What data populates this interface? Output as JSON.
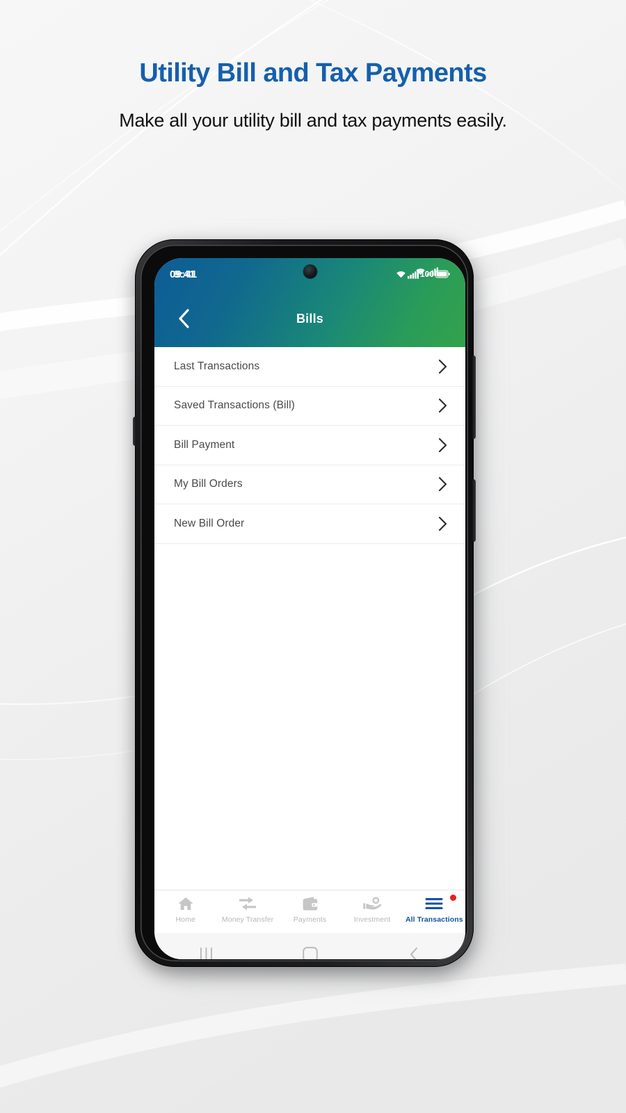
{
  "promo": {
    "title": "Utility Bill and Tax Payments",
    "subtitle": "Make all your utility bill and tax payments easily.",
    "title_color": "#1560ad",
    "subtitle_color": "#111111"
  },
  "phone": {
    "statusbar": {
      "time_primary": "09:41",
      "time_secondary": "9:41",
      "battery_text": "100",
      "icons": [
        "wifi-icon",
        "cellular-signal-icon",
        "wifi-icon",
        "battery-icon"
      ]
    },
    "header": {
      "title": "Bills",
      "back_icon": "chevron-left-icon",
      "gradient_from": "#0d5d96",
      "gradient_to": "#33a24c"
    },
    "menu_items": [
      {
        "label": "Last Transactions",
        "chevron": "chevron-right-icon"
      },
      {
        "label": "Saved Transactions (Bill)",
        "chevron": "chevron-right-icon"
      },
      {
        "label": "Bill Payment",
        "chevron": "chevron-right-icon"
      },
      {
        "label": "My Bill Orders",
        "chevron": "chevron-right-icon"
      },
      {
        "label": "New Bill Order",
        "chevron": "chevron-right-icon"
      }
    ],
    "tabbar": {
      "active_color": "#17529e",
      "inactive_color": "#b6b6b6",
      "badge_color": "#e8201f",
      "tabs": [
        {
          "label": "Home",
          "icon": "home-icon",
          "active": false,
          "badge": false
        },
        {
          "label": "Money Transfer",
          "icon": "transfer-arrows-icon",
          "active": false,
          "badge": false
        },
        {
          "label": "Payments",
          "icon": "wallet-icon",
          "active": false,
          "badge": false
        },
        {
          "label": "Investment",
          "icon": "hand-coin-icon",
          "active": false,
          "badge": false
        },
        {
          "label": "All Transactions",
          "icon": "hamburger-lines-icon",
          "active": true,
          "badge": true
        }
      ]
    },
    "sysnav": [
      {
        "name": "recents-key",
        "icon": "three-bars-icon"
      },
      {
        "name": "home-key",
        "icon": "rounded-square-icon"
      },
      {
        "name": "back-key",
        "icon": "chevron-left-icon"
      }
    ]
  }
}
